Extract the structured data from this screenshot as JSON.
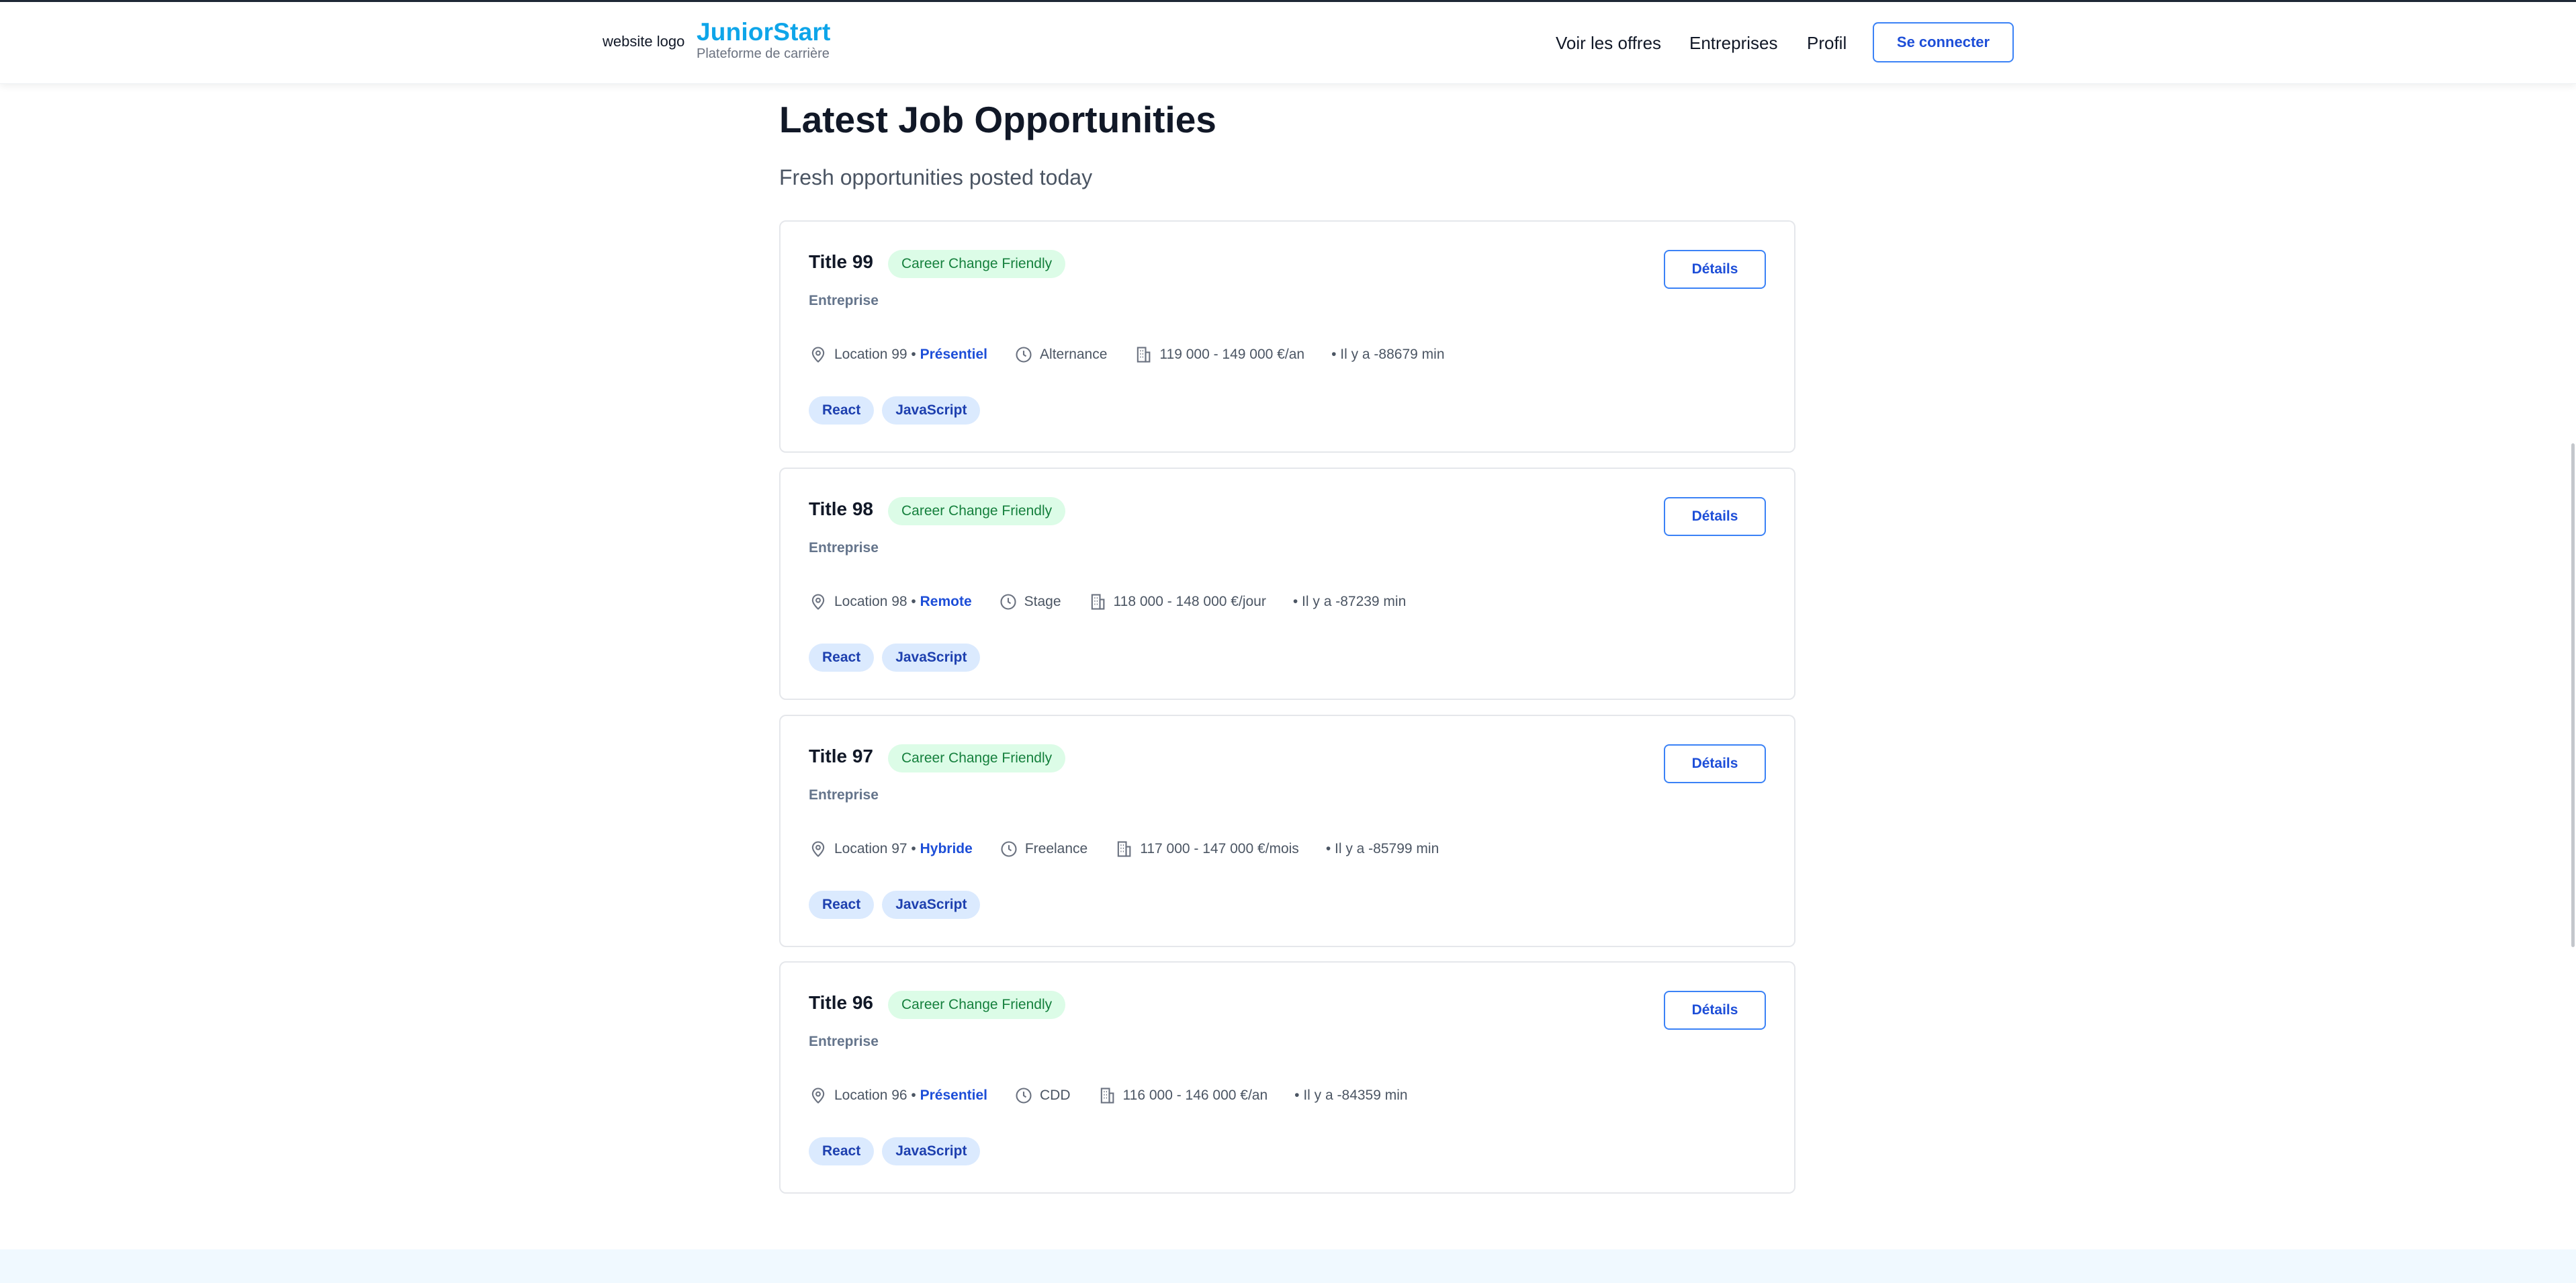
{
  "header": {
    "logo_alt": "website logo",
    "brand": "JuniorStart",
    "tagline": "Plateforme de carrière",
    "nav": [
      "Voir les offres",
      "Entreprises",
      "Profil"
    ],
    "login_label": "Se connecter"
  },
  "main": {
    "title": "Latest Job Opportunities",
    "subtitle": "Fresh opportunities posted today",
    "jobs": [
      {
        "title": "Title 99",
        "badge": "Career Change Friendly",
        "company": "Entreprise",
        "location": "Location 99 •",
        "mode": "Présentiel",
        "contract": "Alternance",
        "salary": "119 000 - 149 000 €/an",
        "posted": "• Il y a -88679 min",
        "tags": [
          "React",
          "JavaScript"
        ],
        "details_label": "Détails"
      },
      {
        "title": "Title 98",
        "badge": "Career Change Friendly",
        "company": "Entreprise",
        "location": "Location 98 •",
        "mode": "Remote",
        "contract": "Stage",
        "salary": "118 000 - 148 000 €/jour",
        "posted": "• Il y a -87239 min",
        "tags": [
          "React",
          "JavaScript"
        ],
        "details_label": "Détails"
      },
      {
        "title": "Title 97",
        "badge": "Career Change Friendly",
        "company": "Entreprise",
        "location": "Location 97 •",
        "mode": "Hybride",
        "contract": "Freelance",
        "salary": "117 000 - 147 000 €/mois",
        "posted": "• Il y a -85799 min",
        "tags": [
          "React",
          "JavaScript"
        ],
        "details_label": "Détails"
      },
      {
        "title": "Title 96",
        "badge": "Career Change Friendly",
        "company": "Entreprise",
        "location": "Location 96 •",
        "mode": "Présentiel",
        "contract": "CDD",
        "salary": "116 000 - 146 000 €/an",
        "posted": "• Il y a -84359 min",
        "tags": [
          "React",
          "JavaScript"
        ],
        "details_label": "Détails"
      }
    ]
  },
  "icons": {
    "location": "map-pin-icon",
    "contract": "clock-icon",
    "salary": "building-icon"
  },
  "colors": {
    "brand": "#0ea5e9",
    "accent": "#1d4ed8",
    "badge_bg": "#dcfce7",
    "badge_text": "#15803d",
    "tag_bg": "#dbeafe"
  }
}
